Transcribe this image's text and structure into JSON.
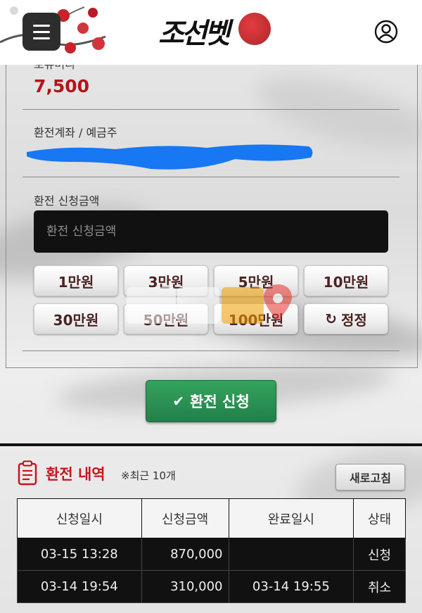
{
  "header": {
    "logo_text": "조선벳"
  },
  "withdraw_form": {
    "amount_label": "보유머니",
    "amount_value": "7,500",
    "account_label": "환전계좌 / 예금주",
    "request_label": "환전 신청금액",
    "request_placeholder": "환전 신청금액",
    "quick_amounts": [
      "1만원",
      "3만원",
      "5만원",
      "10만원",
      "30만원",
      "50만원",
      "100만원"
    ],
    "reset_label": "정정",
    "submit_label": "환전 신청"
  },
  "history": {
    "title": "환전 내역",
    "subtitle": "※최근 10개",
    "refresh_label": "새로고침",
    "columns": [
      "신청일시",
      "신청금액",
      "완료일시",
      "상태"
    ],
    "rows": [
      [
        "03-15 13:28",
        "870,000",
        "",
        "신청"
      ],
      [
        "03-14 19:54",
        "310,000",
        "03-14 19:55",
        "취소"
      ]
    ]
  },
  "colors": {
    "brand_red": "#c7161d",
    "submit_green": "#2a8f50",
    "input_dark": "#111111",
    "redaction_blue": "#1877f2"
  },
  "icons": [
    "menu-icon",
    "user-icon",
    "reset-icon",
    "check-icon",
    "document-icon"
  ]
}
